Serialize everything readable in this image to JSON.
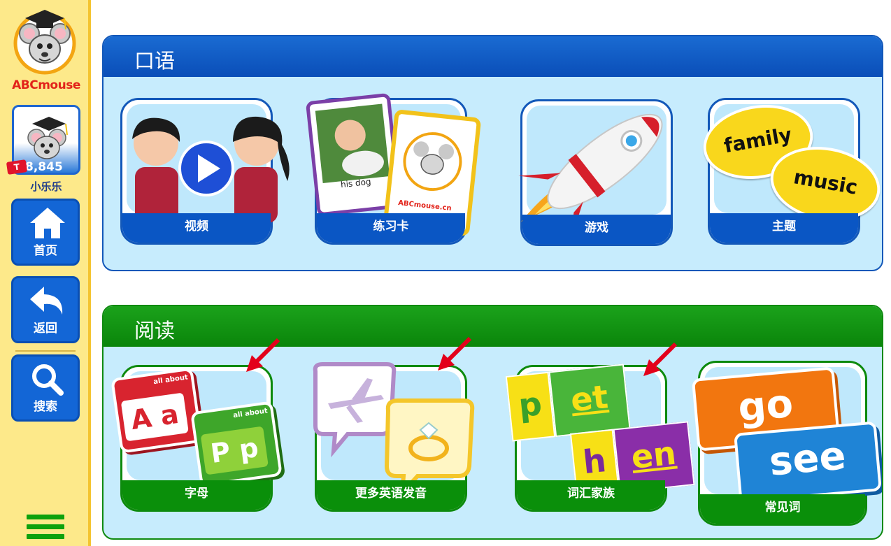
{
  "sidebar": {
    "brand": "ABCmouse",
    "points": "8,845",
    "ticket": "T",
    "username": "小乐乐",
    "home_label": "首页",
    "back_label": "返回",
    "search_label": "搜索"
  },
  "speaking": {
    "title": "口语",
    "tiles": [
      {
        "label": "视频"
      },
      {
        "label": "练习卡",
        "card_caption": "his dog",
        "card_brand": "ABCmouse.cn"
      },
      {
        "label": "游戏"
      },
      {
        "label": "主题",
        "word1": "family",
        "word2": "music"
      }
    ]
  },
  "reading": {
    "title": "阅读",
    "tiles": [
      {
        "label": "字母",
        "block_caption": "all about",
        "letters_red": "A a",
        "letters_green": "P p"
      },
      {
        "label": "更多英语发音"
      },
      {
        "label": "词汇家族",
        "word1_p": "p",
        "word1_rest": "et",
        "word2_h": "h",
        "word2_rest": "en"
      },
      {
        "label": "常见词",
        "word1": "go",
        "word2": "see"
      }
    ]
  },
  "colors": {
    "speaking_header": "#0a56c4",
    "reading_header": "#0a8f0a",
    "sidebar": "#fde98a",
    "arrow": "#e3001b"
  },
  "icons": [
    "mouse-mascot-logo",
    "home-icon",
    "back-arrow-icon",
    "search-icon",
    "menu-icon",
    "play-icon",
    "rocket-icon",
    "airplane-icon",
    "ring-icon",
    "red-pointer-arrow"
  ]
}
